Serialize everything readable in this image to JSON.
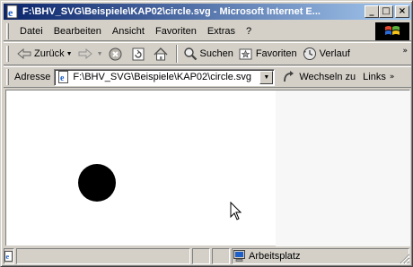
{
  "window": {
    "title": "F:\\BHV_SVG\\Beispiele\\KAP02\\circle.svg - Microsoft Internet E...",
    "minimize_glyph": "_",
    "maximize_glyph": "□",
    "close_glyph": "×"
  },
  "menu": {
    "items": [
      "Datei",
      "Bearbeiten",
      "Ansicht",
      "Favoriten",
      "Extras",
      "?"
    ]
  },
  "toolbar": {
    "back_label": "Zurück",
    "search_label": "Suchen",
    "favorites_label": "Favoriten",
    "history_label": "Verlauf",
    "more_glyph": "»"
  },
  "address": {
    "label": "Adresse",
    "value": "F:\\BHV_SVG\\Beispiele\\KAP02\\circle.svg",
    "go_label": "Wechseln zu",
    "links_label": "Links",
    "links_glyph": "»"
  },
  "status": {
    "zone": "Arbeitsplatz"
  },
  "colors": {
    "titlebar_start": "#0a246a",
    "titlebar_end": "#a6caf0",
    "chrome": "#d4d0c8",
    "circle_fill": "#000000"
  }
}
